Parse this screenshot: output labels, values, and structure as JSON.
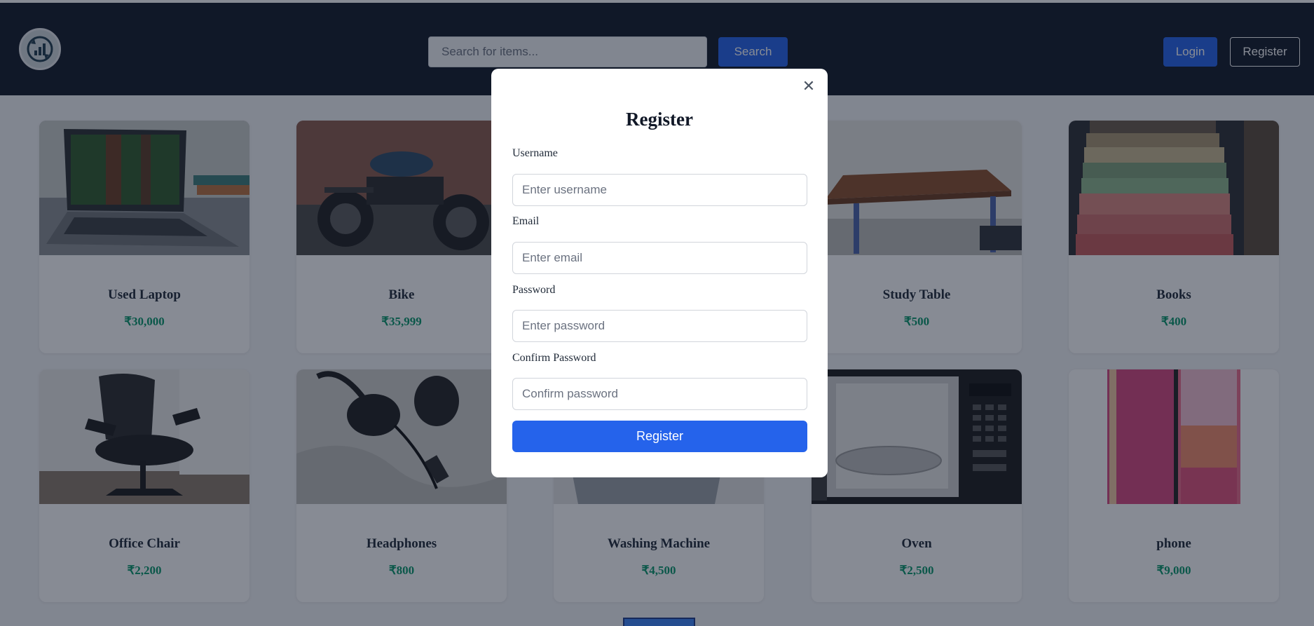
{
  "header": {
    "logo_icon": "recycle-chart-logo-icon",
    "search_placeholder": "Search for items...",
    "search_label": "Search",
    "login_label": "Login",
    "register_label": "Register"
  },
  "products": [
    {
      "title": "Used Laptop",
      "price": "₹30,000",
      "image": "laptop-image"
    },
    {
      "title": "Bike",
      "price": "₹35,999",
      "image": "motorcycle-image"
    },
    {
      "title": "",
      "price": "",
      "image": "hidden-behind-modal"
    },
    {
      "title": "Study Table",
      "price": "₹500",
      "image": "table-image"
    },
    {
      "title": "Books",
      "price": "₹400",
      "image": "books-image"
    },
    {
      "title": "Office Chair",
      "price": "₹2,200",
      "image": "office-chair-image"
    },
    {
      "title": "Headphones",
      "price": "₹800",
      "image": "headphones-image"
    },
    {
      "title": "Washing Machine",
      "price": "₹4,500",
      "image": "washing-machine-image"
    },
    {
      "title": "Oven",
      "price": "₹2,500",
      "image": "microwave-oven-image"
    },
    {
      "title": "phone",
      "price": "₹9,000",
      "image": "lg-velvet-phone-image"
    }
  ],
  "modal": {
    "title": "Register",
    "close_icon": "close-icon",
    "username_label": "Username",
    "username_placeholder": "Enter username",
    "email_label": "Email",
    "email_placeholder": "Enter email",
    "password_label": "Password",
    "password_placeholder": "Enter password",
    "confirm_label": "Confirm Password",
    "confirm_placeholder": "Confirm password",
    "submit_label": "Register"
  },
  "colors": {
    "header_bg": "#111827",
    "primary": "#2563eb",
    "price": "#059669",
    "overlay": "rgba(15,23,42,0.5)"
  }
}
